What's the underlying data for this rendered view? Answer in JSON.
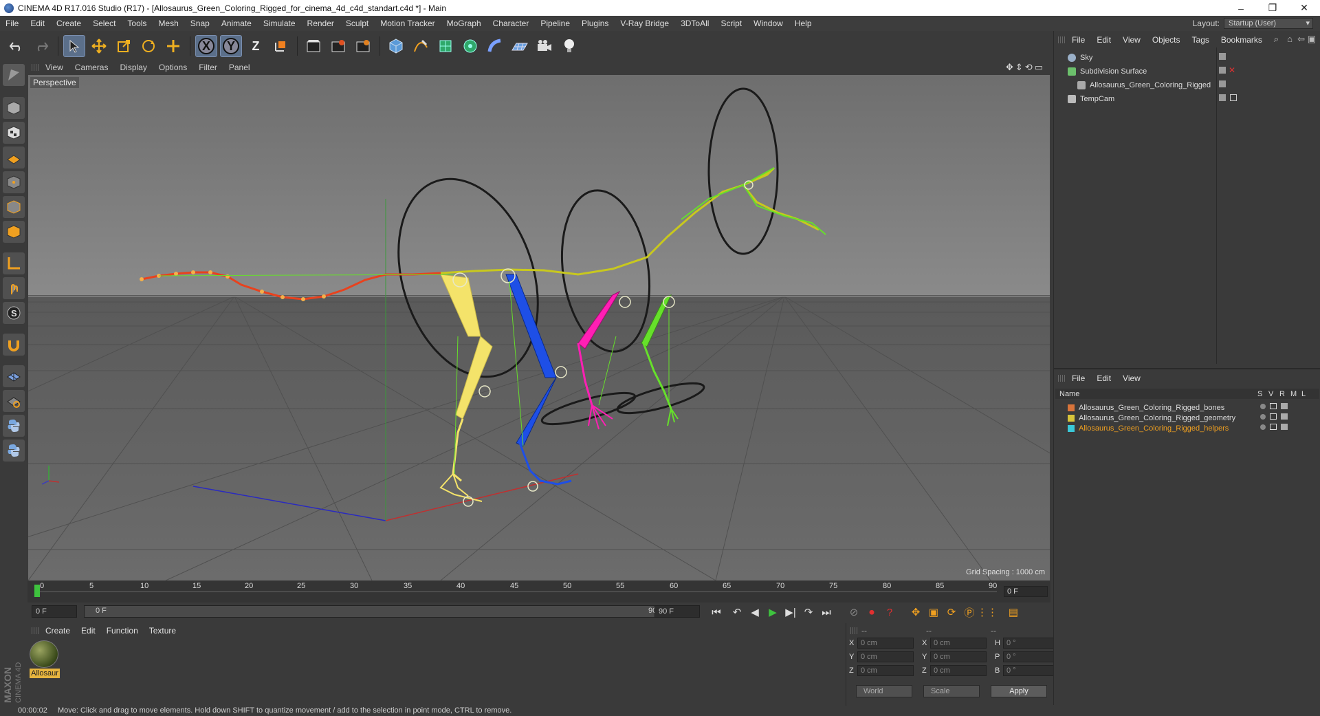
{
  "window": {
    "title": "CINEMA 4D R17.016 Studio (R17) - [Allosaurus_Green_Coloring_Rigged_for_cinema_4d_c4d_standart.c4d *] - Main",
    "min": "–",
    "max": "❐",
    "close": "✕"
  },
  "menubar": [
    "File",
    "Edit",
    "Create",
    "Select",
    "Tools",
    "Mesh",
    "Snap",
    "Animate",
    "Simulate",
    "Render",
    "Sculpt",
    "Motion Tracker",
    "MoGraph",
    "Character",
    "Pipeline",
    "Plugins",
    "V-Ray Bridge",
    "3DToAll",
    "Script",
    "Window",
    "Help"
  ],
  "layout": {
    "label": "Layout:",
    "value": "Startup (User)"
  },
  "toolbar": {
    "axis_x": "X",
    "axis_y": "Y",
    "axis_z": "Z"
  },
  "viewport": {
    "menu": [
      "View",
      "Cameras",
      "Display",
      "Options",
      "Filter",
      "Panel"
    ],
    "label": "Perspective",
    "grid_spacing": "Grid Spacing : 1000 cm",
    "nav_icons": "✥⇕⟲▭"
  },
  "timeline": {
    "ticks": [
      "0",
      "5",
      "10",
      "15",
      "20",
      "25",
      "30",
      "35",
      "40",
      "45",
      "50",
      "55",
      "60",
      "65",
      "70",
      "75",
      "80",
      "85",
      "90"
    ],
    "current_frame": "0 F"
  },
  "transport": {
    "start_field": "0 F",
    "range_start": "0 F",
    "range_end": "90 F",
    "end_field": "90 F"
  },
  "material_panel": {
    "menu": [
      "Create",
      "Edit",
      "Function",
      "Texture"
    ],
    "material_name": "Allosaur"
  },
  "brand": {
    "line1": "MAXON",
    "line2": "CINEMA 4D"
  },
  "coords": {
    "head1": "--",
    "head2": "--",
    "head3": "--",
    "rows": [
      {
        "a1": "X",
        "v1": "0 cm",
        "a2": "X",
        "v2": "0 cm",
        "a3": "H",
        "v3": "0 °"
      },
      {
        "a1": "Y",
        "v1": "0 cm",
        "a2": "Y",
        "v2": "0 cm",
        "a3": "P",
        "v3": "0 °"
      },
      {
        "a1": "Z",
        "v1": "0 cm",
        "a2": "Z",
        "v2": "0 cm",
        "a3": "B",
        "v3": "0 °"
      }
    ],
    "mode1": "World",
    "mode2": "Scale",
    "apply": "Apply"
  },
  "objects_panel": {
    "menu": [
      "File",
      "Edit",
      "View",
      "Objects",
      "Tags",
      "Bookmarks"
    ],
    "items": [
      {
        "name": "Sky",
        "color": "#9ab0c8"
      },
      {
        "name": "Subdivision Surface",
        "color": "#6cc06c"
      },
      {
        "name": "Allosaurus_Green_Coloring_Rigged",
        "color": "#aaaaaa"
      },
      {
        "name": "TempCam",
        "color": "#bbbbbb"
      }
    ]
  },
  "layers_panel": {
    "menu": [
      "File",
      "Edit",
      "View"
    ],
    "headers": {
      "name": "Name",
      "s": "S",
      "v": "V",
      "r": "R",
      "m": "M",
      "l": "L"
    },
    "items": [
      {
        "name": "Allosaurus_Green_Coloring_Rigged_bones",
        "color": "#d9743a"
      },
      {
        "name": "Allosaurus_Green_Coloring_Rigged_geometry",
        "color": "#d8c43a"
      },
      {
        "name": "Allosaurus_Green_Coloring_Rigged_helpers",
        "color": "#3ac8d8"
      }
    ]
  },
  "status": {
    "time": "00:00:02",
    "message": "Move: Click and drag to move elements. Hold down SHIFT to quantize movement / add to the selection in point mode, CTRL to remove."
  },
  "colors": {
    "bone_yellow": "#f4e36a",
    "bone_blue": "#1e4fe6",
    "bone_magenta": "#ff1fb4",
    "bone_green": "#66e02a",
    "bone_red": "#e8421e",
    "bone_olive": "#c8c81e"
  }
}
